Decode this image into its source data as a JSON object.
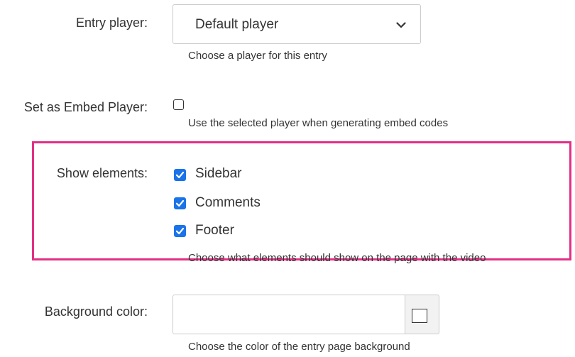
{
  "entry_player": {
    "label": "Entry player:",
    "selected": "Default player",
    "help": "Choose a player for this entry"
  },
  "embed_player": {
    "label": "Set as Embed Player:",
    "checked": false,
    "help": "Use the selected player when generating embed codes"
  },
  "show_elements": {
    "label": "Show elements:",
    "options": [
      {
        "label": "Sidebar",
        "checked": true
      },
      {
        "label": "Comments",
        "checked": true
      },
      {
        "label": "Footer",
        "checked": true
      }
    ],
    "help": "Choose what elements should show on the page with the video",
    "highlight_color": "#e22f86"
  },
  "background_color": {
    "label": "Background color:",
    "value": "",
    "help": "Choose the color of the entry page background",
    "swatch_icon": "color-swatch-icon"
  },
  "colors": {
    "checkbox_accent": "#1a73e8"
  }
}
